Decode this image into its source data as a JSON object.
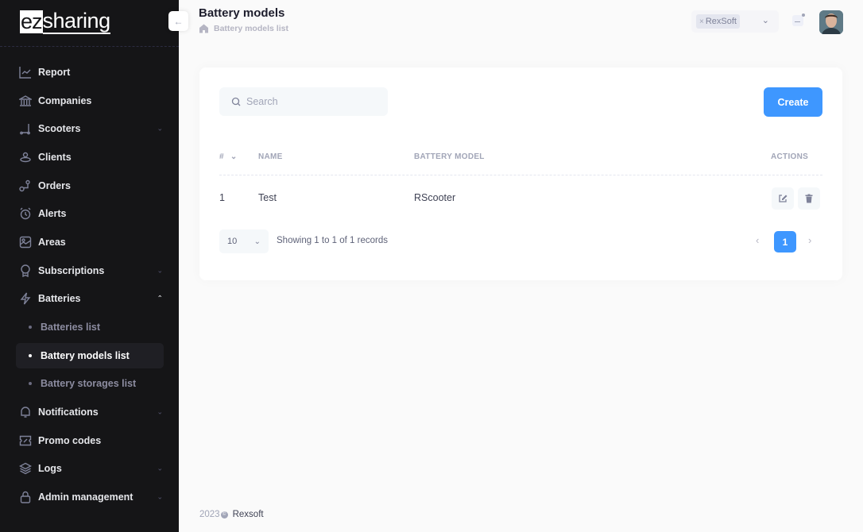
{
  "brand": {
    "logo_prefix": "ez",
    "logo_suffix": "sharing"
  },
  "sidebar": {
    "items": [
      {
        "label": "Report",
        "icon": "chart-line-icon"
      },
      {
        "label": "Companies",
        "icon": "bank-icon"
      },
      {
        "label": "Scooters",
        "icon": "scooter-icon",
        "expandable": true
      },
      {
        "label": "Clients",
        "icon": "users-icon"
      },
      {
        "label": "Orders",
        "icon": "route-icon"
      },
      {
        "label": "Alerts",
        "icon": "alarm-clock-icon"
      },
      {
        "label": "Areas",
        "icon": "map-image-icon"
      },
      {
        "label": "Subscriptions",
        "icon": "award-icon",
        "expandable": true
      },
      {
        "label": "Batteries",
        "icon": "lightning-icon",
        "expanded": true
      },
      {
        "label": "Notifications",
        "icon": "bell-icon",
        "expandable": true
      },
      {
        "label": "Promo codes",
        "icon": "percent-ticket-icon"
      },
      {
        "label": "Logs",
        "icon": "layers-icon",
        "expandable": true
      },
      {
        "label": "Admin management",
        "icon": "lock-icon",
        "expandable": true
      }
    ],
    "batteries_sub": [
      {
        "label": "Batteries list",
        "active": false
      },
      {
        "label": "Battery models list",
        "active": true
      },
      {
        "label": "Battery storages list",
        "active": false
      }
    ]
  },
  "header": {
    "title": "Battery models",
    "breadcrumb": "Battery models list",
    "company_tag": "RexSoft"
  },
  "toolbar": {
    "search_placeholder": "Search",
    "create_label": "Create"
  },
  "table": {
    "columns": [
      "#",
      "NAME",
      "BATTERY MODEL",
      "ACTIONS"
    ],
    "rows": [
      {
        "id": "1",
        "name": "Test",
        "battery_model": "RScooter"
      }
    ]
  },
  "pagination": {
    "page_size": "10",
    "info": "Showing 1 to 1 of 1 records",
    "current_page": "1",
    "prev": "‹",
    "next": "›"
  },
  "footer": {
    "year": "2023",
    "copyright": "©",
    "company": "Rexsoft"
  },
  "colors": {
    "primary": "#3e97ff",
    "sidebar_bg": "#151517"
  }
}
